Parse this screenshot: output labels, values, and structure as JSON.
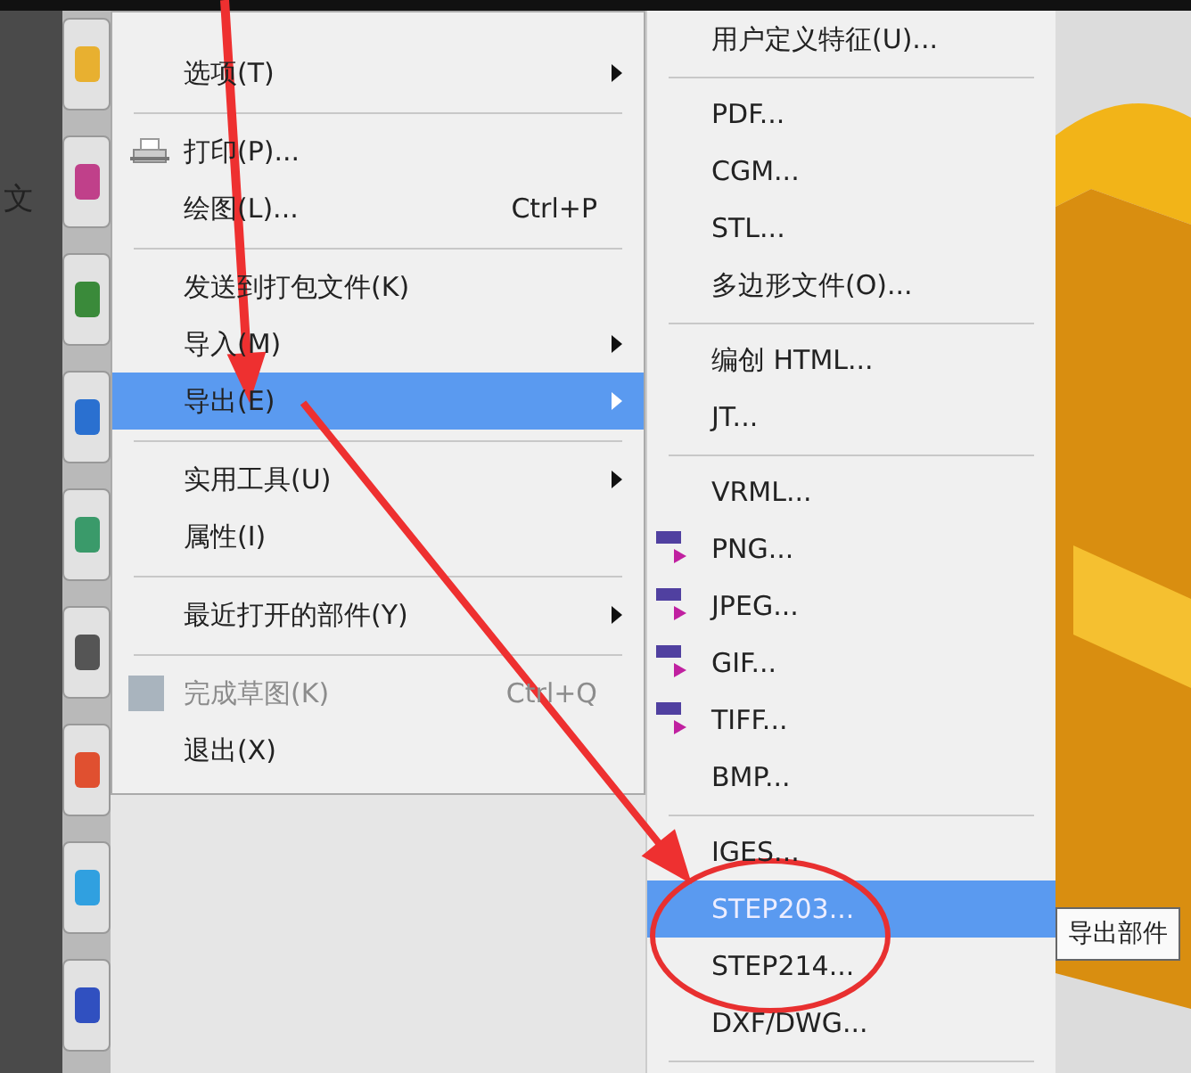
{
  "side_text": "文",
  "main_menu": {
    "items": [
      {
        "kind": "plain",
        "label": "选项(T)",
        "submenu": true,
        "selected": false,
        "disabled": false
      },
      {
        "kind": "separator"
      },
      {
        "kind": "printer",
        "label": "打印(P)...",
        "submenu": false,
        "selected": false,
        "disabled": false
      },
      {
        "kind": "plain",
        "label": "绘图(L)...",
        "shortcut": "Ctrl+P",
        "submenu": false,
        "selected": false,
        "disabled": false
      },
      {
        "kind": "separator"
      },
      {
        "kind": "plain",
        "label": "发送到打包文件(K)",
        "submenu": false,
        "selected": false,
        "disabled": false
      },
      {
        "kind": "plain",
        "label": "导入(M)",
        "submenu": true,
        "selected": false,
        "disabled": false
      },
      {
        "kind": "plain",
        "label": "导出(E)",
        "submenu": true,
        "selected": true,
        "disabled": false
      },
      {
        "kind": "separator"
      },
      {
        "kind": "plain",
        "label": "实用工具(U)",
        "submenu": true,
        "selected": false,
        "disabled": false
      },
      {
        "kind": "plain",
        "label": "属性(I)",
        "submenu": false,
        "selected": false,
        "disabled": false
      },
      {
        "kind": "separator"
      },
      {
        "kind": "plain",
        "label": "最近打开的部件(Y)",
        "submenu": true,
        "selected": false,
        "disabled": false
      },
      {
        "kind": "separator"
      },
      {
        "kind": "sketch",
        "label": "完成草图(K)",
        "shortcut": "Ctrl+Q",
        "submenu": false,
        "selected": false,
        "disabled": true
      },
      {
        "kind": "plain",
        "label": "退出(X)",
        "submenu": false,
        "selected": false,
        "disabled": false
      }
    ]
  },
  "export_submenu": {
    "items": [
      {
        "kind": "plain",
        "label": "用户定义特征(U)...",
        "selected": false
      },
      {
        "kind": "separator"
      },
      {
        "kind": "plain",
        "label": "PDF...",
        "selected": false
      },
      {
        "kind": "plain",
        "label": "CGM...",
        "selected": false
      },
      {
        "kind": "plain",
        "label": "STL...",
        "selected": false
      },
      {
        "kind": "plain",
        "label": "多边形文件(O)...",
        "selected": false
      },
      {
        "kind": "separator"
      },
      {
        "kind": "plain",
        "label": "编创 HTML...",
        "selected": false
      },
      {
        "kind": "plain",
        "label": "JT...",
        "selected": false
      },
      {
        "kind": "separator"
      },
      {
        "kind": "plain",
        "label": "VRML...",
        "selected": false
      },
      {
        "kind": "image",
        "label": "PNG...",
        "selected": false
      },
      {
        "kind": "image",
        "label": "JPEG...",
        "selected": false
      },
      {
        "kind": "image",
        "label": "GIF...",
        "selected": false
      },
      {
        "kind": "image",
        "label": "TIFF...",
        "selected": false
      },
      {
        "kind": "plain",
        "label": "BMP...",
        "selected": false
      },
      {
        "kind": "separator"
      },
      {
        "kind": "plain",
        "label": "IGES...",
        "selected": false
      },
      {
        "kind": "plain",
        "label": "STEP203...",
        "selected": true
      },
      {
        "kind": "plain",
        "label": "STEP214...",
        "selected": false
      },
      {
        "kind": "plain",
        "label": "DXF/DWG...",
        "selected": false
      },
      {
        "kind": "separator"
      }
    ]
  },
  "tooltip": "导出部件"
}
